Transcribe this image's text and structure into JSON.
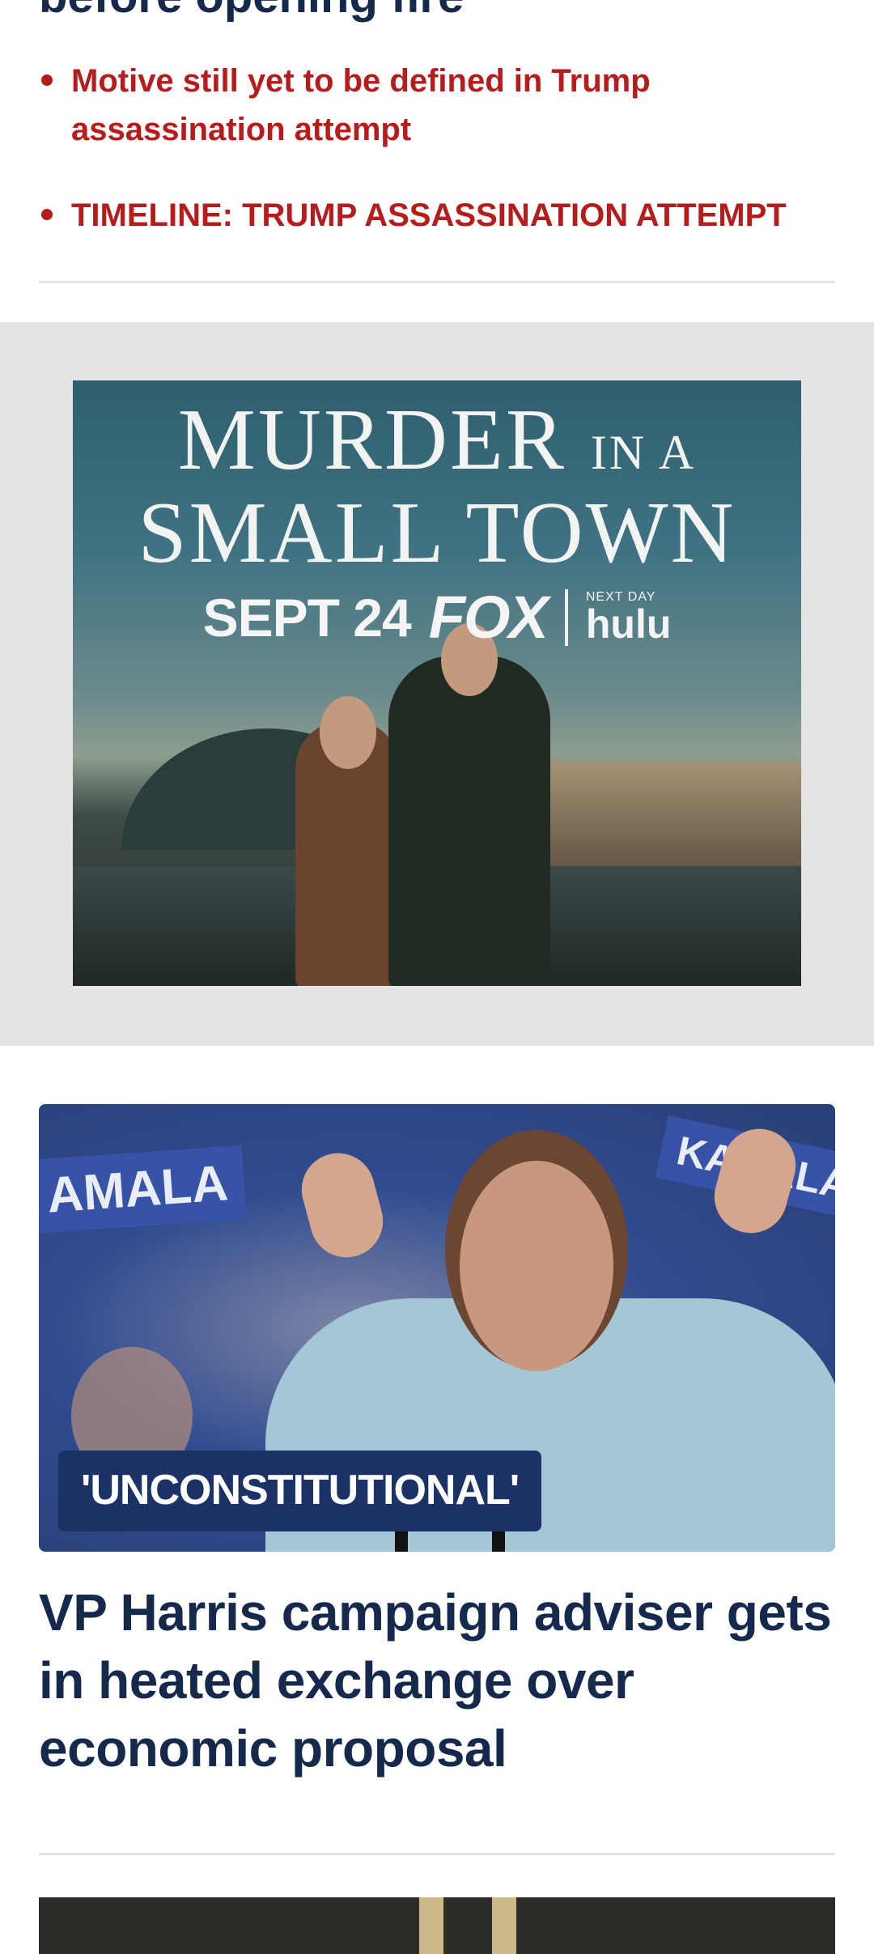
{
  "top_story": {
    "headline_fragment": "before opening fire",
    "related": [
      {
        "text": "Motive still yet to be defined in Trump assassination attempt"
      },
      {
        "text": "TIMELINE: TRUMP ASSASSINATION ATTEMPT"
      }
    ]
  },
  "ad": {
    "title_line1_main": "MURDER",
    "title_line1_small": "IN A",
    "title_line2": "SMALL TOWN",
    "date": "SEPT 24",
    "network": "FOX",
    "stream_small": "NEXT DAY",
    "stream_name": "hulu"
  },
  "story": {
    "image_sign_text_1": "AMALA",
    "image_sign_text_2": "KAMALA",
    "kicker": "'UNCONSTITUTIONAL'",
    "headline": "VP Harris campaign adviser gets in heated exchange over economic proposal"
  },
  "colors": {
    "headline_navy": "#15294d",
    "link_red": "#b61c1c",
    "kicker_bg": "#1c3266",
    "ad_background": "#e4e4e4"
  }
}
